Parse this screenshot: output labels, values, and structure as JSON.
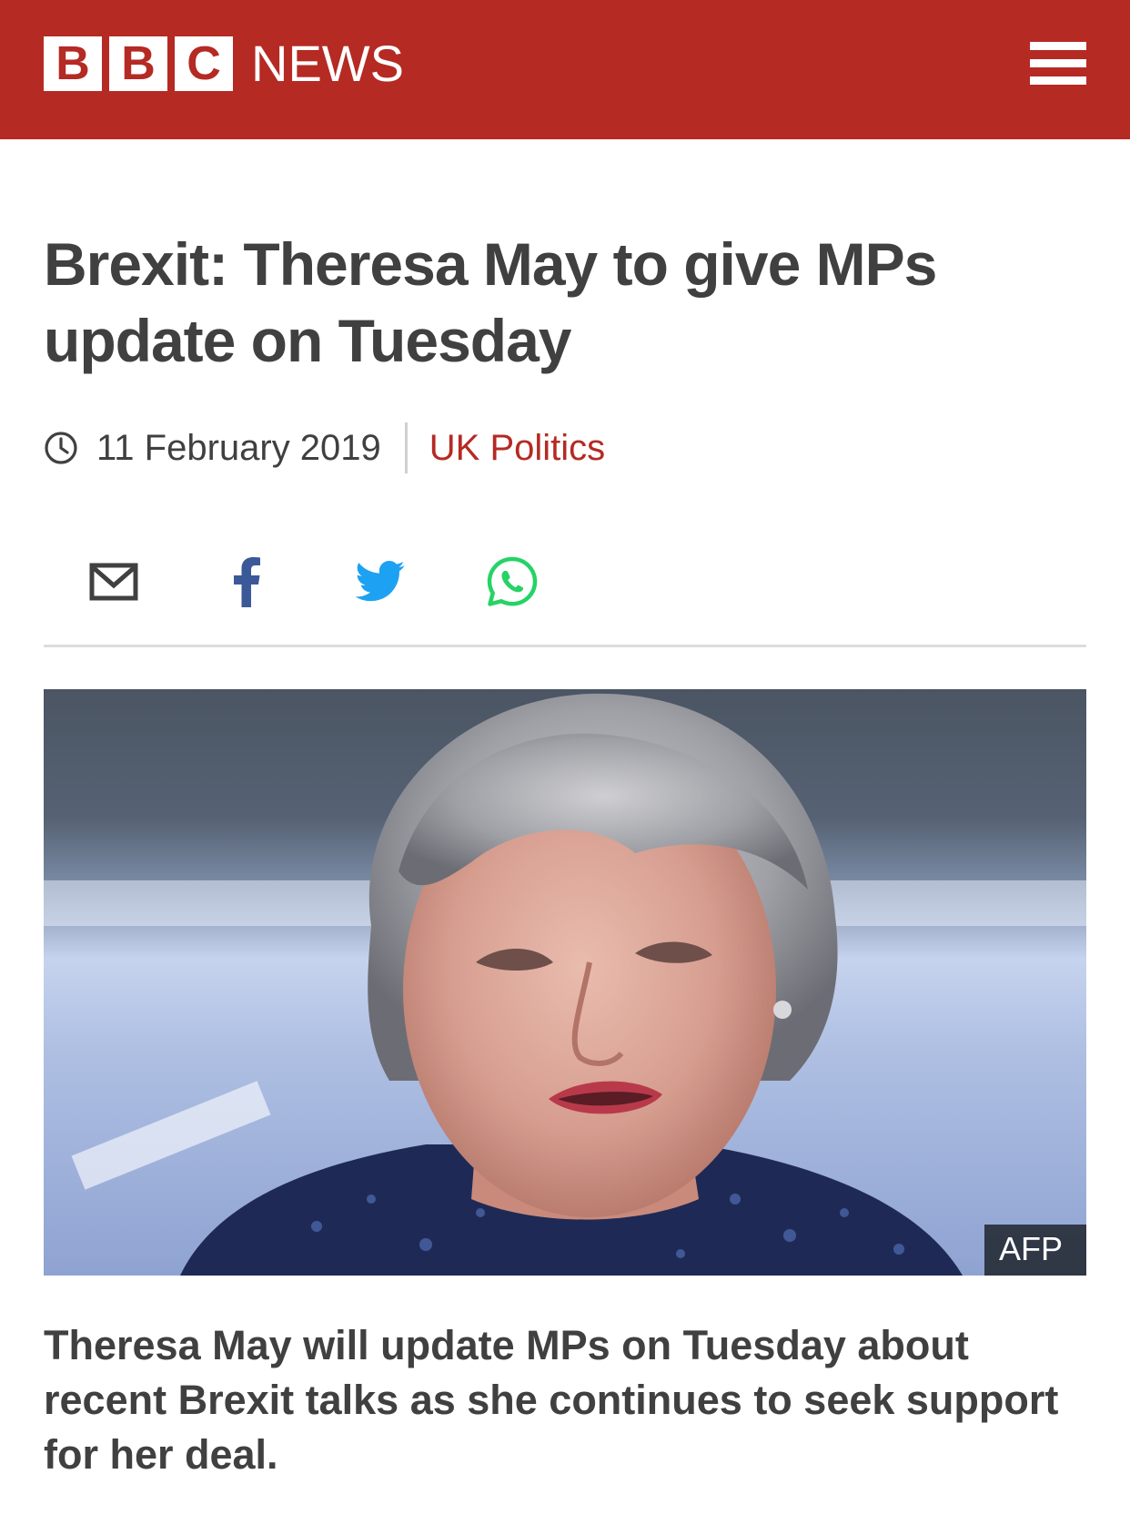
{
  "header": {
    "logo_letters": [
      "B",
      "B",
      "C"
    ],
    "logo_word": "NEWS",
    "brand_color": "#b52a23",
    "menu_icon": "hamburger-menu-icon"
  },
  "article": {
    "headline": "Brexit: Theresa May to give MPs update on Tuesday",
    "date": "11 February 2019",
    "section": "UK Politics",
    "section_color": "#b52a23",
    "image_credit": "AFP",
    "intro": "Theresa May will update MPs on Tuesday about recent Brexit talks as she continues to seek support for her deal."
  },
  "share": {
    "items": [
      {
        "name": "email",
        "icon": "email-icon",
        "color": "#404040"
      },
      {
        "name": "facebook",
        "icon": "facebook-icon",
        "color": "#3b5998"
      },
      {
        "name": "twitter",
        "icon": "twitter-icon",
        "color": "#1da1f2"
      },
      {
        "name": "whatsapp",
        "icon": "whatsapp-icon",
        "color": "#25d366"
      }
    ]
  }
}
